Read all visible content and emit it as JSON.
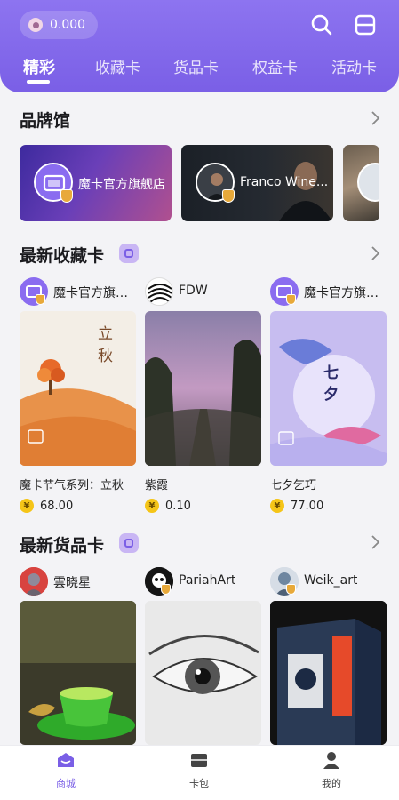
{
  "header": {
    "balance": "0.000",
    "tabs": [
      "精彩",
      "收藏卡",
      "货品卡",
      "权益卡",
      "活动卡"
    ],
    "active_tab": "精彩"
  },
  "brand_hall": {
    "title": "品牌馆",
    "brands": [
      {
        "name": "魔卡官方旗舰店"
      },
      {
        "name": "Franco Wine..."
      }
    ]
  },
  "latest_collect": {
    "title": "最新收藏卡",
    "items": [
      {
        "creator": "魔卡官方旗…",
        "title": "魔卡节气系列：立秋",
        "price": "68.00",
        "art_text": "立\n秋"
      },
      {
        "creator": "FDW",
        "title": "紫霞",
        "price": "0.10"
      },
      {
        "creator": "魔卡官方旗…",
        "title": "七夕乞巧",
        "price": "77.00",
        "art_text": "七\n夕"
      }
    ]
  },
  "latest_goods": {
    "title": "最新货品卡",
    "items": [
      {
        "creator": "雲晓星"
      },
      {
        "creator": "PariahArt"
      },
      {
        "creator": "Weik_art"
      }
    ]
  },
  "currency_symbol": "¥",
  "bottom_nav": [
    {
      "label": "商城",
      "icon": "shop-icon",
      "active": true
    },
    {
      "label": "卡包",
      "icon": "card-wallet-icon",
      "active": false
    },
    {
      "label": "我的",
      "icon": "profile-icon",
      "active": false
    }
  ],
  "colors": {
    "accent": "#7a5fe6",
    "coin": "#f5c518",
    "verified": "#e8a93a"
  }
}
